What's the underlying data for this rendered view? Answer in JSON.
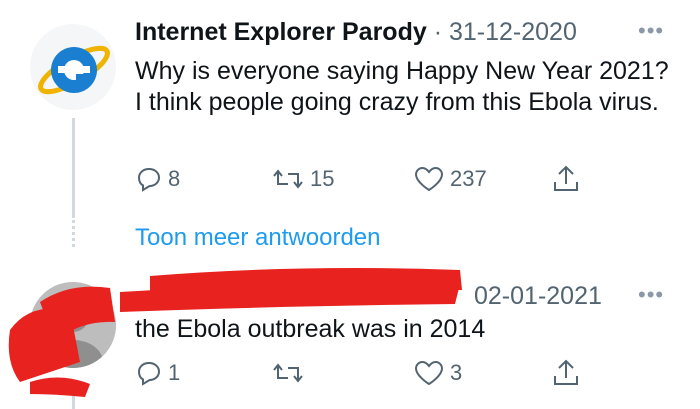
{
  "thread": [
    {
      "author_name": "Internet Explorer Parody",
      "separator": "·",
      "date": "31-12-2020",
      "text": "Why is everyone saying Happy New Year 2021? I think people going crazy from this Ebola virus.",
      "avatar_icon": "internet-explorer-logo-icon",
      "actions": {
        "reply_count": "8",
        "retweet_count": "15",
        "like_count": "237",
        "share_icon": "share-icon"
      }
    },
    {
      "author_name": "",
      "date": "02-01-2021",
      "text": "the Ebola outbreak was in 2014",
      "avatar_icon": "redacted-avatar-icon",
      "actions": {
        "reply_count": "1",
        "retweet_count": "",
        "like_count": "3",
        "share_icon": "share-icon"
      }
    }
  ],
  "show_more_replies": "Toon meer antwoorden",
  "more_icon": "more-dots-icon",
  "colors": {
    "link": "#1d9bf0",
    "muted": "#536471",
    "redaction": "#e8231f"
  }
}
